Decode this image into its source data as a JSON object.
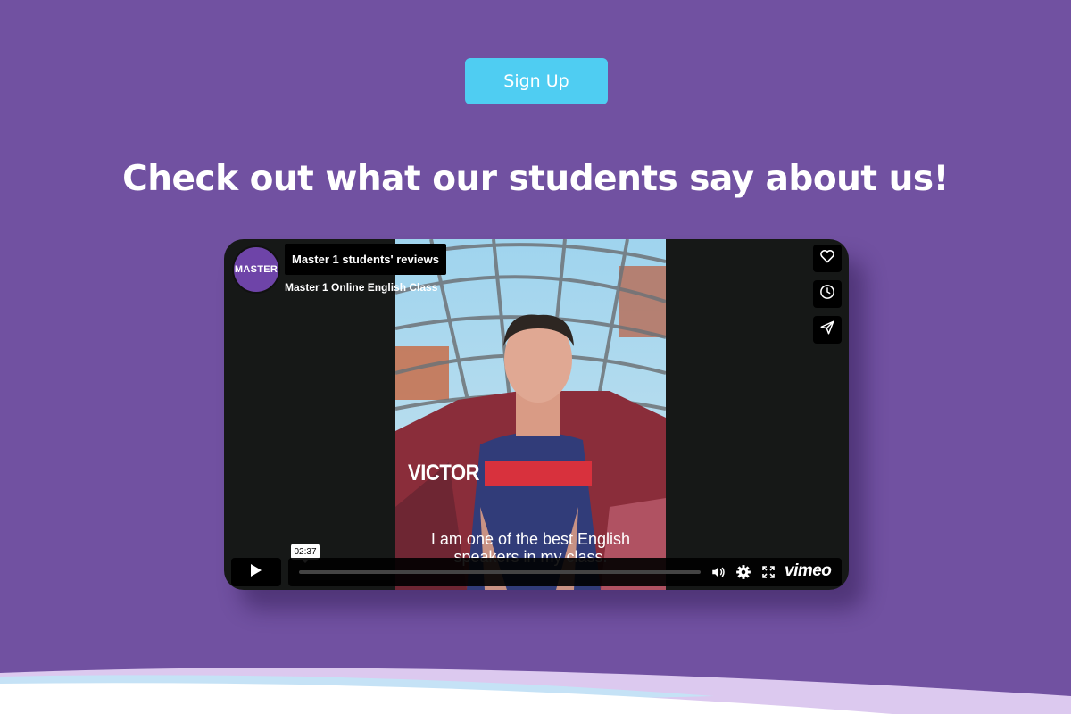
{
  "page": {
    "signup_label": "Sign Up",
    "heading": "Check out what our students say about us!"
  },
  "video": {
    "channel_avatar_text": "MASTER",
    "title": "Master 1 students' reviews",
    "byline": "Master 1 Online English Class",
    "name_overlay": "VICTOR",
    "caption_line1": "I am one of the best English",
    "caption_line2": "speakers in my class.",
    "timestamp": "02:37",
    "brand": "vimeo"
  },
  "icons": {
    "like": "heart-icon",
    "watch_later": "clock-icon",
    "share": "send-icon",
    "play": "play-icon",
    "volume": "volume-icon",
    "settings": "gear-icon",
    "fullscreen": "fullscreen-icon"
  },
  "colors": {
    "background": "#7151a1",
    "button": "#4fcdf2",
    "player": "#161817"
  }
}
